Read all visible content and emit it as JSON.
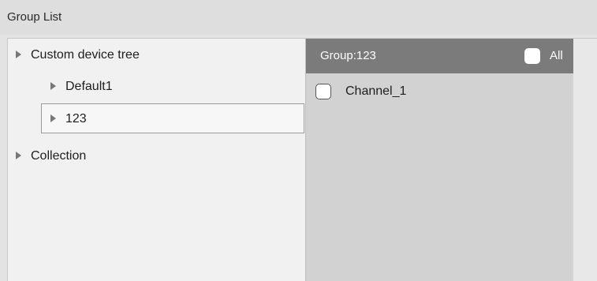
{
  "panel": {
    "title": "Group List"
  },
  "tree": {
    "items": [
      {
        "label": "Custom device tree"
      },
      {
        "label": "Default1"
      },
      {
        "label": "123"
      },
      {
        "label": "Collection"
      }
    ]
  },
  "channels": {
    "header_group": "Group:123",
    "all_label": "All",
    "all_checked": false,
    "rows": [
      {
        "label": "Channel_1",
        "checked": false
      }
    ]
  },
  "colors": {
    "header_bg": "#7b7b7b",
    "tree_bg": "#f1f1f1",
    "list_bg": "#d2d2d2"
  }
}
